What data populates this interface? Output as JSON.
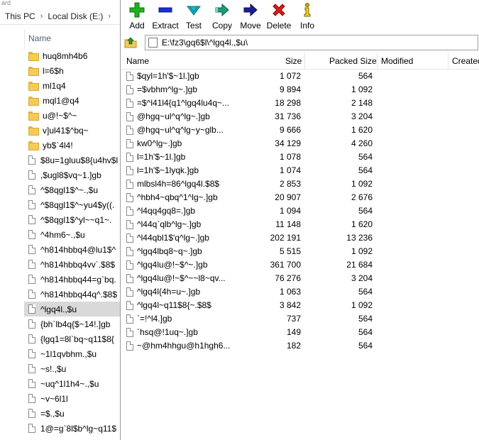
{
  "explorer": {
    "topstrip_text": "ard",
    "breadcrumb": [
      "This PC",
      "Local Disk (E:)"
    ],
    "column_header": "Name",
    "items": [
      {
        "type": "folder",
        "name": "huq8mh4b6"
      },
      {
        "type": "folder",
        "name": "l=6$h"
      },
      {
        "type": "folder",
        "name": "ml1q4"
      },
      {
        "type": "folder",
        "name": "mql1@q4"
      },
      {
        "type": "folder",
        "name": "u@!~$^~"
      },
      {
        "type": "folder",
        "name": "v]ul41$^bq~"
      },
      {
        "type": "folder",
        "name": "yb$`4l4!"
      },
      {
        "type": "file",
        "name": "$8u=1gluu$8{u4hv$l"
      },
      {
        "type": "file",
        "name": ",$ugl8$vq~1.]gb"
      },
      {
        "type": "file",
        "name": "^$8qgl1$^~.,$u"
      },
      {
        "type": "file",
        "name": "^$8qgl1$^~yu4$y((."
      },
      {
        "type": "file",
        "name": "^$8qgl1$^yl~~q1~."
      },
      {
        "type": "file",
        "name": "^4hm6~.,$u"
      },
      {
        "type": "file",
        "name": "^h814hbbq4@lu1$^"
      },
      {
        "type": "file",
        "name": "^h814hbbq4vv`.$8$"
      },
      {
        "type": "file",
        "name": "^h814hbbq44=g`bq."
      },
      {
        "type": "file",
        "name": "^h814hbbq44q^.$8$"
      },
      {
        "type": "file",
        "name": "^lgq4l.,$u",
        "selected": true
      },
      {
        "type": "file",
        "name": "{bh`lb4q{$~14!.]gb"
      },
      {
        "type": "file",
        "name": "{lgq1=8l`bq~q11$8{"
      },
      {
        "type": "file",
        "name": "~1l1qvbhm.,$u"
      },
      {
        "type": "file",
        "name": "~s!.,$u"
      },
      {
        "type": "file",
        "name": "~uq^1l1h4~.,$u"
      },
      {
        "type": "file",
        "name": "~v~6l1l"
      },
      {
        "type": "file",
        "name": "=$.,$u"
      },
      {
        "type": "file",
        "name": "1@=g`8l$b^lg~q11$"
      }
    ]
  },
  "sevenzip": {
    "toolbar": [
      {
        "id": "add",
        "label": "Add",
        "icon": "plus-icon",
        "color": "#1bb31b"
      },
      {
        "id": "extract",
        "label": "Extract",
        "icon": "minus-icon",
        "color": "#1a2fd6"
      },
      {
        "id": "test",
        "label": "Test",
        "icon": "checkmark-icon",
        "color": "#18b8c8"
      },
      {
        "id": "copy",
        "label": "Copy",
        "icon": "copy-arrow-icon",
        "color": "#1a9c7a"
      },
      {
        "id": "move",
        "label": "Move",
        "icon": "move-arrow-icon",
        "color": "#1a2090"
      },
      {
        "id": "delete",
        "label": "Delete",
        "icon": "delete-x-icon",
        "color": "#e01818"
      },
      {
        "id": "info",
        "label": "Info",
        "icon": "info-icon",
        "color": "#c8a400"
      }
    ],
    "path": "E:\\fz3\\gq6$l\\^lgq4l.,$u\\",
    "columns": {
      "name": "Name",
      "size": "Size",
      "packed": "Packed Size",
      "modified": "Modified",
      "created": "Created"
    },
    "files": [
      {
        "name": "$qyl=1h'$~1l.]gb",
        "size": "1 072",
        "packed": "564"
      },
      {
        "name": "=$vbhm^lg~.]gb",
        "size": "9 894",
        "packed": "1 092"
      },
      {
        "name": "=$^l41l4{q1^lgq4lu4q~...",
        "size": "18 298",
        "packed": "2 148"
      },
      {
        "name": "@hgq~ul^q^lg~.]gb",
        "size": "31 736",
        "packed": "3 204"
      },
      {
        "name": "@hgq~ul^q^lg~y~glb...",
        "size": "9 666",
        "packed": "1 620"
      },
      {
        "name": "kw0^lg~.]gb",
        "size": "34 129",
        "packed": "4 260"
      },
      {
        "name": "l=1h'$~1l.]gb",
        "size": "1 078",
        "packed": "564"
      },
      {
        "name": "l=1h'$~1lyqk.]gb",
        "size": "1 074",
        "packed": "564"
      },
      {
        "name": "mlbsl4h=86^lgq4l.$8$",
        "size": "2 853",
        "packed": "1 092"
      },
      {
        "name": "^hbh4~qbq^1^lg~.]gb",
        "size": "20 907",
        "packed": "2 676"
      },
      {
        "name": "^l4qq4gq8=.]gb",
        "size": "1 094",
        "packed": "564"
      },
      {
        "name": "^l44q`qlb^lg~.]gb",
        "size": "11 148",
        "packed": "1 620"
      },
      {
        "name": "^l44qbl1$'q^lg~.]gb",
        "size": "202 191",
        "packed": "13 236"
      },
      {
        "name": "^lgq4lbq8~q~.]gb",
        "size": "5 515",
        "packed": "1 092"
      },
      {
        "name": "^lgq4lu@!~$^~.]gb",
        "size": "361 700",
        "packed": "21 684"
      },
      {
        "name": "^lgq4lu@!~$^~~l8~qv...",
        "size": "76 276",
        "packed": "3 204"
      },
      {
        "name": "^lgq4l{4h=u~.]gb",
        "size": "1 063",
        "packed": "564"
      },
      {
        "name": "^lgq4l~q11$8{~.$8$",
        "size": "3 842",
        "packed": "1 092"
      },
      {
        "name": "`=!^l4.]gb",
        "size": "737",
        "packed": "564"
      },
      {
        "name": "`hsq@!1uq~.]gb",
        "size": "149",
        "packed": "564"
      },
      {
        "name": "~@hm4hhgu@h1hgh6...",
        "size": "182",
        "packed": "564"
      }
    ]
  }
}
